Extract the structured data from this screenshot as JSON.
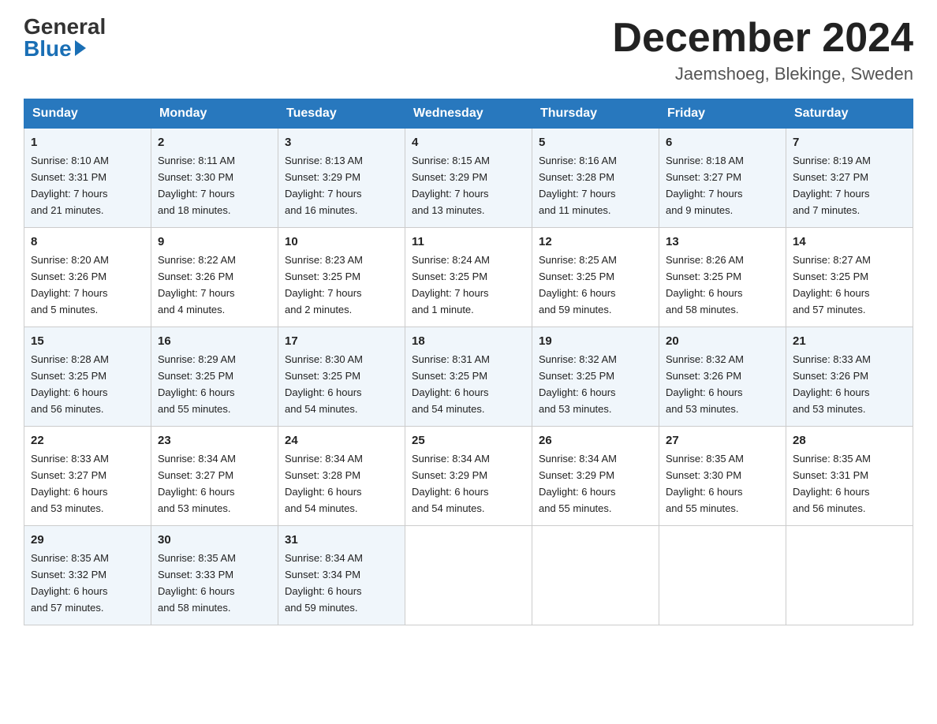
{
  "header": {
    "logo_general": "General",
    "logo_blue": "Blue",
    "month_title": "December 2024",
    "location": "Jaemshoeg, Blekinge, Sweden"
  },
  "days_of_week": [
    "Sunday",
    "Monday",
    "Tuesday",
    "Wednesday",
    "Thursday",
    "Friday",
    "Saturday"
  ],
  "weeks": [
    [
      {
        "day": "1",
        "info": "Sunrise: 8:10 AM\nSunset: 3:31 PM\nDaylight: 7 hours\nand 21 minutes."
      },
      {
        "day": "2",
        "info": "Sunrise: 8:11 AM\nSunset: 3:30 PM\nDaylight: 7 hours\nand 18 minutes."
      },
      {
        "day": "3",
        "info": "Sunrise: 8:13 AM\nSunset: 3:29 PM\nDaylight: 7 hours\nand 16 minutes."
      },
      {
        "day": "4",
        "info": "Sunrise: 8:15 AM\nSunset: 3:29 PM\nDaylight: 7 hours\nand 13 minutes."
      },
      {
        "day": "5",
        "info": "Sunrise: 8:16 AM\nSunset: 3:28 PM\nDaylight: 7 hours\nand 11 minutes."
      },
      {
        "day": "6",
        "info": "Sunrise: 8:18 AM\nSunset: 3:27 PM\nDaylight: 7 hours\nand 9 minutes."
      },
      {
        "day": "7",
        "info": "Sunrise: 8:19 AM\nSunset: 3:27 PM\nDaylight: 7 hours\nand 7 minutes."
      }
    ],
    [
      {
        "day": "8",
        "info": "Sunrise: 8:20 AM\nSunset: 3:26 PM\nDaylight: 7 hours\nand 5 minutes."
      },
      {
        "day": "9",
        "info": "Sunrise: 8:22 AM\nSunset: 3:26 PM\nDaylight: 7 hours\nand 4 minutes."
      },
      {
        "day": "10",
        "info": "Sunrise: 8:23 AM\nSunset: 3:25 PM\nDaylight: 7 hours\nand 2 minutes."
      },
      {
        "day": "11",
        "info": "Sunrise: 8:24 AM\nSunset: 3:25 PM\nDaylight: 7 hours\nand 1 minute."
      },
      {
        "day": "12",
        "info": "Sunrise: 8:25 AM\nSunset: 3:25 PM\nDaylight: 6 hours\nand 59 minutes."
      },
      {
        "day": "13",
        "info": "Sunrise: 8:26 AM\nSunset: 3:25 PM\nDaylight: 6 hours\nand 58 minutes."
      },
      {
        "day": "14",
        "info": "Sunrise: 8:27 AM\nSunset: 3:25 PM\nDaylight: 6 hours\nand 57 minutes."
      }
    ],
    [
      {
        "day": "15",
        "info": "Sunrise: 8:28 AM\nSunset: 3:25 PM\nDaylight: 6 hours\nand 56 minutes."
      },
      {
        "day": "16",
        "info": "Sunrise: 8:29 AM\nSunset: 3:25 PM\nDaylight: 6 hours\nand 55 minutes."
      },
      {
        "day": "17",
        "info": "Sunrise: 8:30 AM\nSunset: 3:25 PM\nDaylight: 6 hours\nand 54 minutes."
      },
      {
        "day": "18",
        "info": "Sunrise: 8:31 AM\nSunset: 3:25 PM\nDaylight: 6 hours\nand 54 minutes."
      },
      {
        "day": "19",
        "info": "Sunrise: 8:32 AM\nSunset: 3:25 PM\nDaylight: 6 hours\nand 53 minutes."
      },
      {
        "day": "20",
        "info": "Sunrise: 8:32 AM\nSunset: 3:26 PM\nDaylight: 6 hours\nand 53 minutes."
      },
      {
        "day": "21",
        "info": "Sunrise: 8:33 AM\nSunset: 3:26 PM\nDaylight: 6 hours\nand 53 minutes."
      }
    ],
    [
      {
        "day": "22",
        "info": "Sunrise: 8:33 AM\nSunset: 3:27 PM\nDaylight: 6 hours\nand 53 minutes."
      },
      {
        "day": "23",
        "info": "Sunrise: 8:34 AM\nSunset: 3:27 PM\nDaylight: 6 hours\nand 53 minutes."
      },
      {
        "day": "24",
        "info": "Sunrise: 8:34 AM\nSunset: 3:28 PM\nDaylight: 6 hours\nand 54 minutes."
      },
      {
        "day": "25",
        "info": "Sunrise: 8:34 AM\nSunset: 3:29 PM\nDaylight: 6 hours\nand 54 minutes."
      },
      {
        "day": "26",
        "info": "Sunrise: 8:34 AM\nSunset: 3:29 PM\nDaylight: 6 hours\nand 55 minutes."
      },
      {
        "day": "27",
        "info": "Sunrise: 8:35 AM\nSunset: 3:30 PM\nDaylight: 6 hours\nand 55 minutes."
      },
      {
        "day": "28",
        "info": "Sunrise: 8:35 AM\nSunset: 3:31 PM\nDaylight: 6 hours\nand 56 minutes."
      }
    ],
    [
      {
        "day": "29",
        "info": "Sunrise: 8:35 AM\nSunset: 3:32 PM\nDaylight: 6 hours\nand 57 minutes."
      },
      {
        "day": "30",
        "info": "Sunrise: 8:35 AM\nSunset: 3:33 PM\nDaylight: 6 hours\nand 58 minutes."
      },
      {
        "day": "31",
        "info": "Sunrise: 8:34 AM\nSunset: 3:34 PM\nDaylight: 6 hours\nand 59 minutes."
      },
      null,
      null,
      null,
      null
    ]
  ]
}
